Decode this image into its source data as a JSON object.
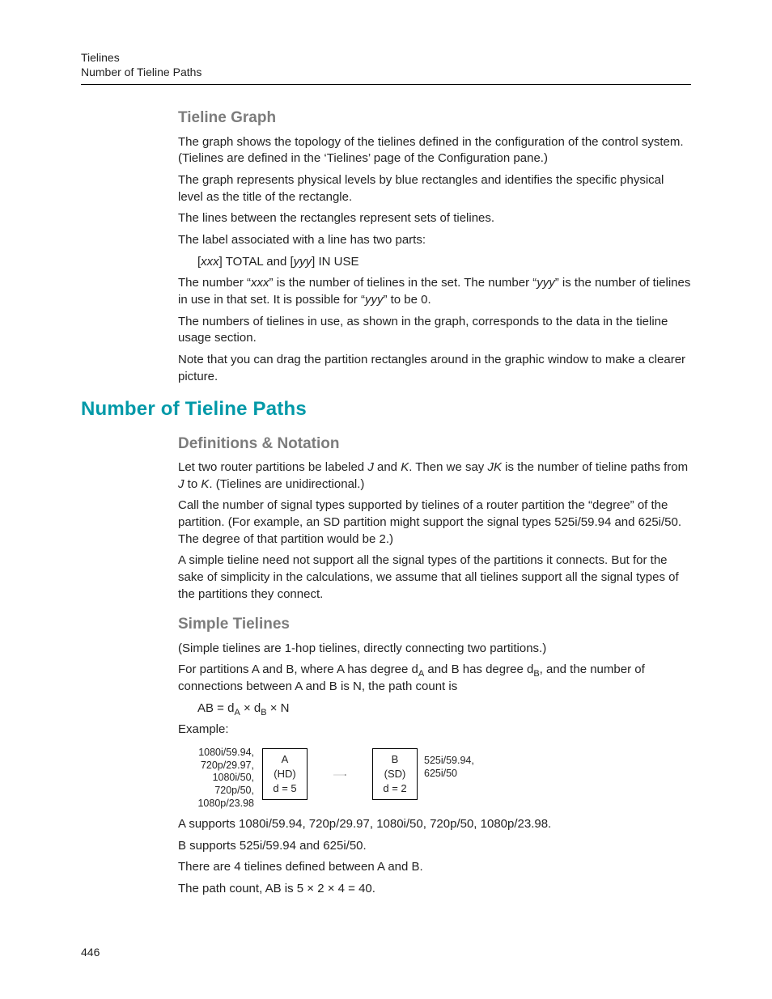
{
  "header": {
    "line1": "Tielines",
    "line2": "Number of Tieline Paths"
  },
  "sec1": {
    "title": "Tieline Graph",
    "p1": "The graph shows the topology of the tielines defined in the configuration of the control system. (Tielines are defined in the ‘Tielines’ page of the Configuration pane.)",
    "p2": "The graph represents physical levels by blue rectangles and identifies the specific physical level as the title of the rectangle.",
    "p3": "The lines between the rectangles represent sets of tielines.",
    "p4": "The label associated with a line has two parts:",
    "label_pre": "[",
    "label_xxx": "xxx",
    "label_mid": "] TOTAL and [",
    "label_yyy": "yyy",
    "label_end": "] IN USE",
    "p5a": "The number “",
    "p5b": "xxx",
    "p5c": "” is the number of tielines in the set. The number “",
    "p5d": "yyy",
    "p5e": "” is the number of tielines in use in that set. It is possible for “",
    "p5f": "yyy",
    "p5g": "” to be 0.",
    "p6": "The numbers of tielines in use, as shown in the graph, corresponds to the data in the tieline usage section.",
    "p7": "Note that you can drag the partition rectangles around in the graphic window to make a clearer picture."
  },
  "sec2": {
    "title": "Number of Tieline Paths"
  },
  "defs": {
    "title": "Definitions & Notation",
    "p1a": "Let two router partitions be labeled ",
    "p1b": "J",
    "p1c": " and ",
    "p1d": "K",
    "p1e": ". Then we say ",
    "p1f": "JK",
    "p1g": " is the number of tieline paths from ",
    "p1h": "J",
    "p1i": " to ",
    "p1j": "K",
    "p1k": ". (Tielines are unidirectional.)",
    "p2": "Call the number of signal types supported by tielines of a router partition the “degree” of the partition. (For example, an SD partition might support the signal types 525i/59.94 and 625i/50. The degree of that partition would be 2.)",
    "p3": "A simple tieline need not support all the signal types of the partitions it connects. But for the sake of simplicity in the calculations, we assume that all tielines support all the signal types of the partitions they connect."
  },
  "simple": {
    "title": "Simple Tielines",
    "p1": "(Simple tielines are 1-hop tielines, directly connecting two partitions.)",
    "p2a": "For partitions A and B, where A has degree d",
    "p2b": "A",
    "p2c": " and B has degree d",
    "p2d": "B",
    "p2e": ", and the number of connections between A and B is N, the path count is",
    "formula": {
      "a": "AB = d",
      "b": "A",
      "c": " × d",
      "d": "B",
      "e": " × N"
    },
    "example_label": "Example:",
    "p3": "A supports 1080i/59.94, 720p/29.97, 1080i/50, 720p/50, 1080p/23.98.",
    "p4": "B supports 525i/59.94 and 625i/50.",
    "p5": "There are 4 tielines defined between A and B.",
    "p6": "The path count, AB is 5 × 2 × 4 = 40."
  },
  "diagram": {
    "a_labels": "1080i/59.94,\n720p/29.97,\n1080i/50,\n720p/50,\n1080p/23.98",
    "box_a_line1": "A",
    "box_a_line2": "(HD)",
    "box_a_line3": "d = 5",
    "box_b_line1": "B",
    "box_b_line2": "(SD)",
    "box_b_line3": "d = 2",
    "b_labels": "525i/59.94,\n625i/50"
  },
  "page_number": "446"
}
